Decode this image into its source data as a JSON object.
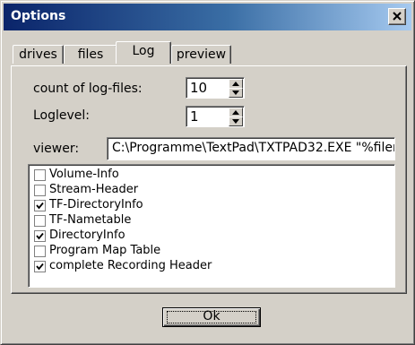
{
  "window": {
    "title": "Options"
  },
  "tabs": [
    {
      "label": "drives"
    },
    {
      "label": "files"
    },
    {
      "label": "Log"
    },
    {
      "label": "preview"
    }
  ],
  "log": {
    "count_label": "count of log-files:",
    "count_value": "10",
    "loglevel_label": "Loglevel:",
    "loglevel_value": "1",
    "viewer_label": "viewer:",
    "viewer_value": "C:\\Programme\\TextPad\\TXTPAD32.EXE \"%filen"
  },
  "options": [
    {
      "label": "Volume-Info",
      "checked": false
    },
    {
      "label": "Stream-Header",
      "checked": false
    },
    {
      "label": "TF-DirectoryInfo",
      "checked": true
    },
    {
      "label": "TF-Nametable",
      "checked": false
    },
    {
      "label": "DirectoryInfo",
      "checked": true
    },
    {
      "label": "Program Map Table",
      "checked": false
    },
    {
      "label": "complete Recording Header",
      "checked": true
    }
  ],
  "ok_label": "Ok"
}
